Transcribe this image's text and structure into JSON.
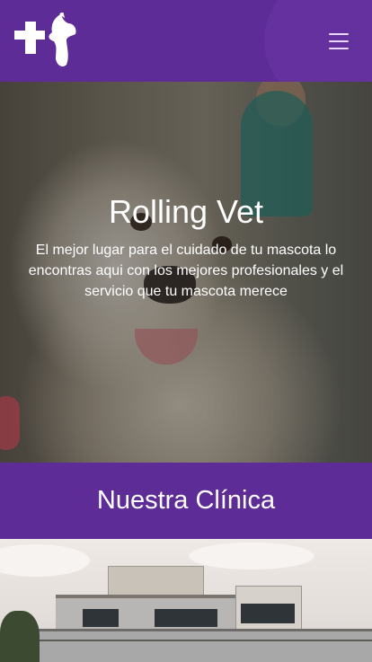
{
  "navbar": {
    "logo_icon": "cross-and-pets-logo",
    "menu_icon": "hamburger-menu-icon",
    "colors": {
      "background": "#5e2c97"
    }
  },
  "hero": {
    "title": "Rolling Vet",
    "description": "El mejor lugar para el cuidado de tu mascota lo encontras aqui con los mejores profesionales y el servicio que tu mascota merece"
  },
  "clinic_section": {
    "title": "Nuestra Clínica"
  }
}
